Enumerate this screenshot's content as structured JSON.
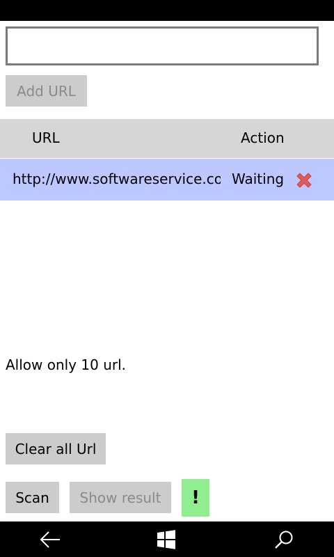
{
  "url_input": {
    "value": "",
    "placeholder": ""
  },
  "add_url_button": {
    "label": "Add URL",
    "enabled": false
  },
  "table": {
    "headers": {
      "url": "URL",
      "action": "Action"
    },
    "rows": [
      {
        "url": "http://www.softwareservice.com",
        "status": "Waiting",
        "remove_icon": "close-icon",
        "remove_color": "#e05a5a"
      }
    ],
    "header_bg": "#d6d6d6",
    "row_bg": "#bcc8ff"
  },
  "info": {
    "text": "Allow only 10 url."
  },
  "buttons": {
    "clear_all": "Clear all Url",
    "scan": "Scan",
    "show_result": "Show result",
    "show_result_enabled": false,
    "alert": "!"
  },
  "colors": {
    "button_bg": "#cccccc",
    "alert_bg": "#90ee90",
    "system_bar": "#000000"
  },
  "nav": {
    "icons": [
      "back-icon",
      "windows-icon",
      "search-icon"
    ]
  }
}
